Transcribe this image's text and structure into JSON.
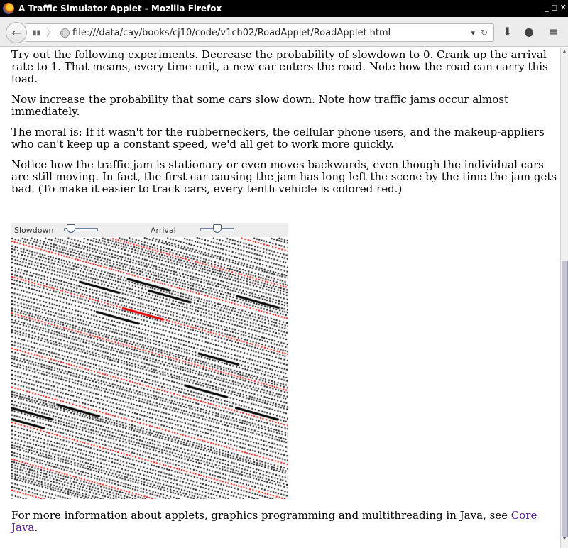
{
  "window": {
    "title": "A Traffic Simulator Applet - Mozilla Firefox",
    "controls": "_ ◻ ✕"
  },
  "navbar": {
    "url": "file:///data/cay/books/cj10/code/v1ch02/RoadApplet/RoadApplet.html"
  },
  "content": {
    "paragraphs": [
      "Try out the following experiments. Decrease the probability of slowdown to 0. Crank up the arrival rate to 1. That means, every time unit, a new car enters the road. Note how the road can carry this load.",
      "Now increase the probability that some cars slow down. Note how traffic jams occur almost immediately.",
      "The moral is: If it wasn't for the rubberneckers, the cellular phone users, and the makeup-appliers who can't keep up a constant speed, we'd all get to work more quickly.",
      "Notice how the traffic jam is stationary or even moves backwards, even though the individual cars are still moving. In fact, the first car causing the jam has long left the scene by the time the jam gets bad. (To make it easier to track cars, every tenth vehicle is colored red.)"
    ],
    "footer_text": "For more information about applets, graphics programming and multithreading in Java, see ",
    "footer_link": "Core Java",
    "footer_end": "."
  },
  "applet": {
    "slowdown_label": "Slowdown",
    "slowdown_value": 0.1,
    "arrival_label": "Arrival",
    "arrival_value": 0.5,
    "car_color": "#000000",
    "tenth_car_color": "#e00000"
  }
}
